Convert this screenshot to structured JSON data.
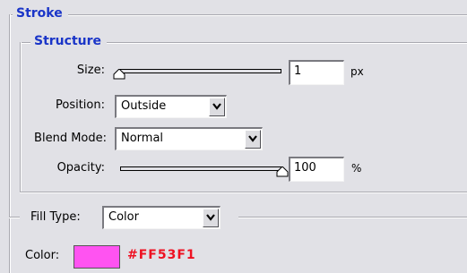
{
  "stroke": {
    "title": "Stroke",
    "structure": {
      "title": "Structure",
      "size": {
        "label": "Size:",
        "value": "1",
        "unit": "px",
        "slider_fraction": 0.0
      },
      "position": {
        "label": "Position:",
        "value": "Outside"
      },
      "blend_mode": {
        "label": "Blend Mode:",
        "value": "Normal"
      },
      "opacity": {
        "label": "Opacity:",
        "value": "100",
        "unit": "%",
        "slider_fraction": 1.0
      }
    },
    "fill": {
      "type_label": "Fill Type:",
      "type_value": "Color",
      "color_label": "Color:",
      "color_hex": "#FF53F1",
      "swatch_color": "#ff53f1"
    }
  },
  "colors": {
    "panel_bg": "#e1e1e6",
    "section_title": "#1a35c8",
    "hex_text": "#ee1122"
  },
  "icons": {
    "dropdown": "chevron-down-icon",
    "slider_thumb": "slider-thumb-icon"
  }
}
